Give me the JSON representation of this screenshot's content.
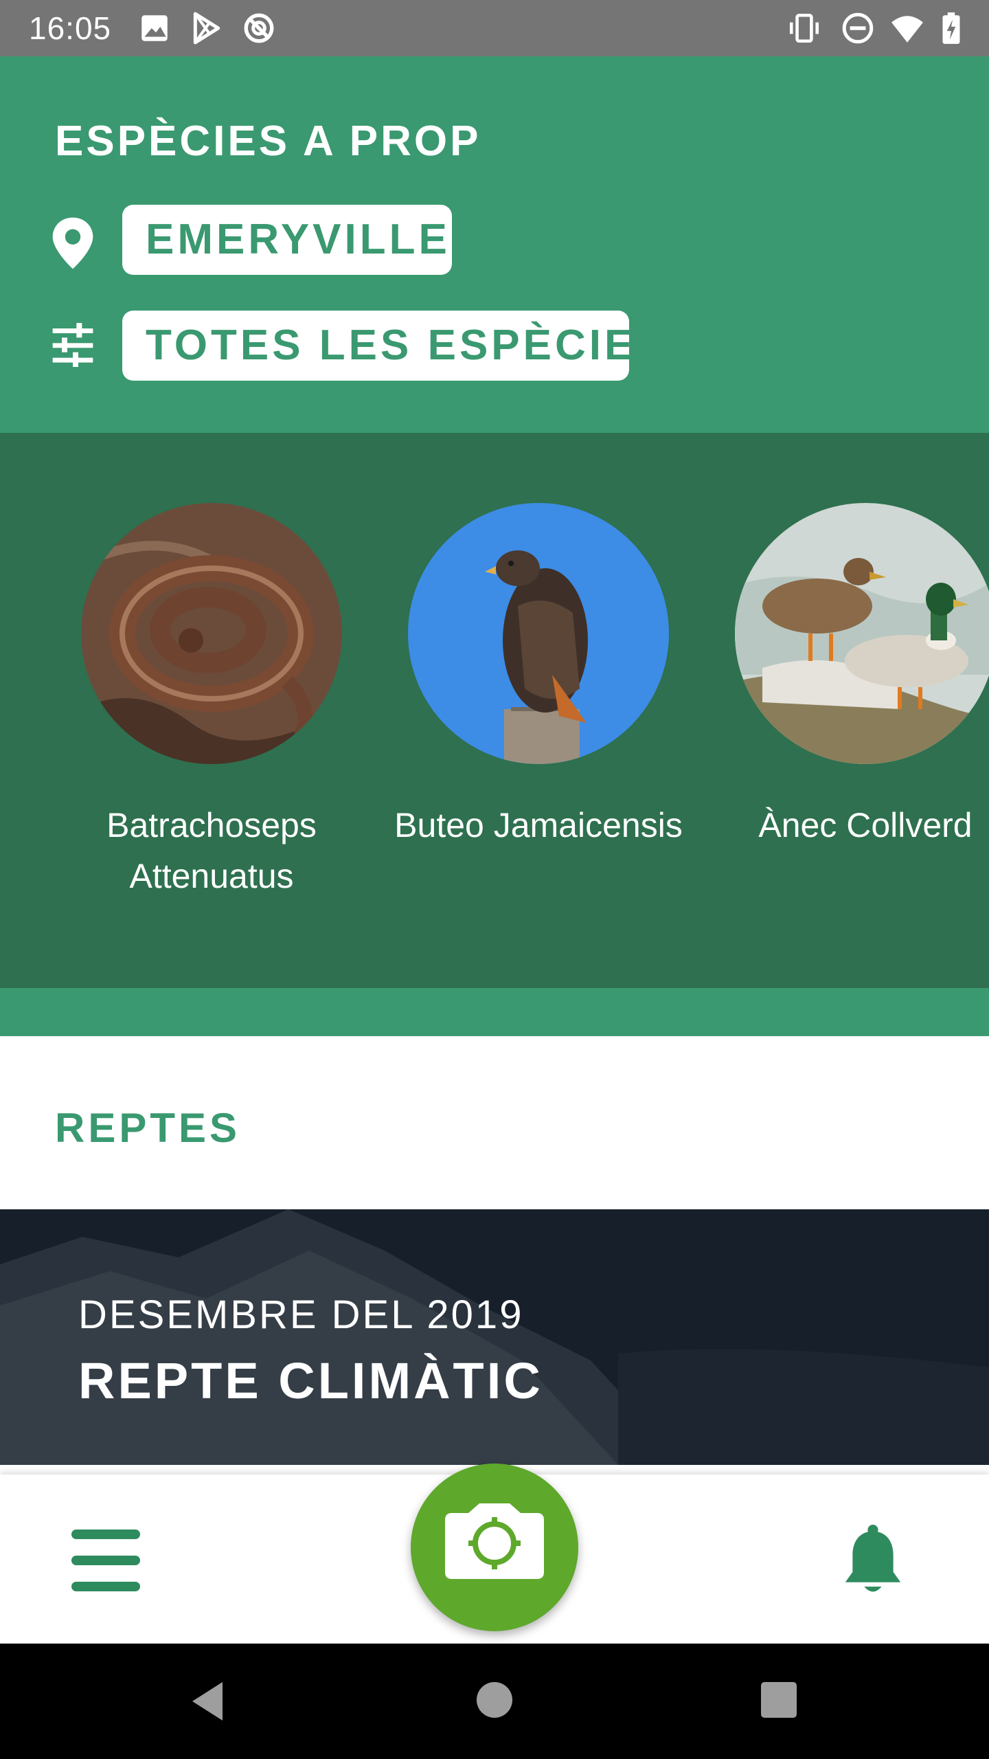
{
  "status_bar": {
    "time": "16:05",
    "icons_left": [
      "image-icon",
      "play-store-icon",
      "sync-icon"
    ],
    "icons_right": [
      "vibrate-icon",
      "do-not-disturb-icon",
      "wifi-icon",
      "battery-charging-icon"
    ]
  },
  "header": {
    "title": "ESPÈCIES A PROP",
    "location_label": "EMERYVILLE",
    "filter_label": "TOTES LES ESPÈCIES",
    "background_color": "#3a9970"
  },
  "species": [
    {
      "name": "Batrachoseps Attenuatus",
      "photo": "salamander"
    },
    {
      "name": "Buteo Jamaicensis",
      "photo": "hawk"
    },
    {
      "name": "Ànec Collverd",
      "photo": "mallard-ducks"
    }
  ],
  "reptes": {
    "section_title": "REPTES",
    "challenge": {
      "month": "DESEMBRE DEL 2019",
      "title": "REPTE CLIMÀTIC"
    }
  },
  "bottom_bar": {
    "menu_icon": "hamburger-menu-icon",
    "camera_icon": "camera-icon",
    "notifications_icon": "bell-icon",
    "accent_color": "#5ea82c"
  },
  "nav_bar": [
    "back-icon",
    "home-icon",
    "recents-icon"
  ]
}
